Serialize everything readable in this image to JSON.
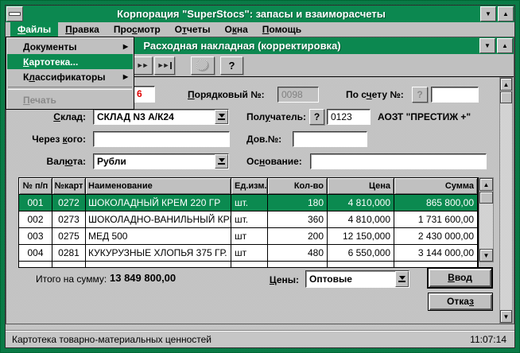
{
  "window": {
    "title": "Корпорация \"SuperStocs\": запасы и взаиморасчеты"
  },
  "menu_bar": {
    "items": [
      {
        "id": "files",
        "pre": "",
        "key": "Ф",
        "post": "айлы",
        "selected": true
      },
      {
        "id": "edit",
        "pre": "",
        "key": "П",
        "post": "равка"
      },
      {
        "id": "view",
        "pre": "Про",
        "key": "с",
        "post": "мотр"
      },
      {
        "id": "reports",
        "pre": "О",
        "key": "т",
        "post": "четы"
      },
      {
        "id": "windows",
        "pre": "О",
        "key": "к",
        "post": "на"
      },
      {
        "id": "help",
        "pre": "",
        "key": "П",
        "post": "омощь"
      }
    ]
  },
  "file_menu": {
    "items": [
      {
        "id": "documents",
        "pre": "",
        "key": "Д",
        "post": "окументы",
        "submenu": true
      },
      {
        "id": "card-index",
        "pre": "",
        "key": "К",
        "post": "артотека...",
        "highlighted": true
      },
      {
        "id": "classifiers",
        "pre": "К",
        "key": "л",
        "post": "ассификаторы",
        "submenu": true
      },
      {
        "type": "separator"
      },
      {
        "id": "print",
        "pre": "",
        "key": "П",
        "post": "ечать",
        "disabled": true
      }
    ]
  },
  "document_window": {
    "title": "Расходная накладная (корректировка)",
    "toolbar": {
      "next_icon": "►►",
      "last_icon": "►►",
      "help_label": "?"
    },
    "fields": {
      "doc_number": {
        "value": "6"
      },
      "serial": {
        "label": {
          "pre": "",
          "key": "П",
          "post": "орядковый №:"
        },
        "value": "0098"
      },
      "account": {
        "label": {
          "pre": "По с",
          "key": "ч",
          "post": "ету №:"
        },
        "help": "?",
        "value": ""
      },
      "warehouse": {
        "label": {
          "pre": "",
          "key": "С",
          "post": "клад:"
        },
        "value": "СКЛАД N3 А/К24"
      },
      "recipient": {
        "label": {
          "pre": "Пол",
          "key": "у",
          "post": "чатель:"
        },
        "help": "?",
        "code": "0123",
        "name": "АОЗТ \"ПРЕСТИЖ +\""
      },
      "via": {
        "label": {
          "pre": "Через ",
          "key": "к",
          "post": "ого:"
        },
        "value": ""
      },
      "attorney": {
        "label": {
          "pre": "",
          "key": "Д",
          "post": "ов.№:"
        },
        "value": ""
      },
      "currency": {
        "label": {
          "pre": "Вал",
          "key": "ю",
          "post": "та:"
        },
        "value": "Рубли"
      },
      "basis": {
        "label": {
          "pre": "Ос",
          "key": "н",
          "post": "ование:"
        },
        "value": ""
      }
    },
    "table": {
      "headers": [
        "№ п/п",
        "№карт",
        "Наименование",
        "Ед.изм.",
        "Кол-во",
        "Цена",
        "Сумма"
      ],
      "rows": [
        {
          "num": "001",
          "card": "0272",
          "name": "ШОКОЛАДНЫЙ КРЕМ 220 ГР",
          "unit": "шт.",
          "qty": "180",
          "price": "4 810,000",
          "sum": "865 800,00",
          "selected": true
        },
        {
          "num": "002",
          "card": "0273",
          "name": "ШОКОЛАДНО-ВАНИЛЬНЫЙ КРЕМ",
          "unit": "шт.",
          "qty": "360",
          "price": "4 810,000",
          "sum": "1 731 600,00"
        },
        {
          "num": "003",
          "card": "0275",
          "name": "МЕД 500",
          "unit": "шт",
          "qty": "200",
          "price": "12 150,000",
          "sum": "2 430 000,00"
        },
        {
          "num": "004",
          "card": "0281",
          "name": "КУКУРУЗНЫЕ ХЛОПЬЯ 375 ГР.",
          "unit": "шт",
          "qty": "480",
          "price": "6 550,000",
          "sum": "3 144 000,00"
        }
      ]
    },
    "totals": {
      "label": "Итого на сумму:",
      "value": "13 849 800,00"
    },
    "prices": {
      "label": {
        "pre": "",
        "key": "Ц",
        "post": "ены:"
      },
      "value": "Оптовые"
    },
    "buttons": {
      "enter": {
        "pre": "",
        "key": "В",
        "post": "вод"
      },
      "cancel": {
        "pre": "Отка",
        "key": "з",
        "post": ""
      }
    }
  },
  "status_bar": {
    "text": "Картотека товарно-материальных ценностей",
    "time": "11:07:14"
  },
  "colors": {
    "title_green": "#0c8a52",
    "highlight_green": "#0b8a50",
    "border_green": "#0a7f4a",
    "red_text": "#e00000"
  }
}
